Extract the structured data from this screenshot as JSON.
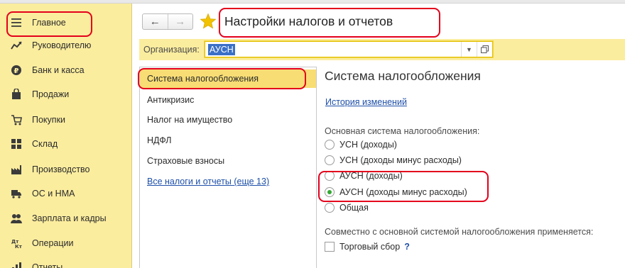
{
  "sidebar": {
    "items": [
      {
        "label": "Главное",
        "icon": "menu-lines-icon"
      },
      {
        "label": "Руководителю",
        "icon": "trend-chart-icon"
      },
      {
        "label": "Банк и касса",
        "icon": "ruble-coin-icon"
      },
      {
        "label": "Продажи",
        "icon": "shopping-bag-icon"
      },
      {
        "label": "Покупки",
        "icon": "cart-icon"
      },
      {
        "label": "Склад",
        "icon": "warehouse-grid-icon"
      },
      {
        "label": "Производство",
        "icon": "factory-icon"
      },
      {
        "label": "ОС и НМА",
        "icon": "truck-icon"
      },
      {
        "label": "Зарплата и кадры",
        "icon": "people-icon"
      },
      {
        "label": "Операции",
        "icon": "dt-kt-icon"
      },
      {
        "label": "Отчеты",
        "icon": "report-chart-icon"
      }
    ]
  },
  "header": {
    "title": "Настройки налогов и отчетов"
  },
  "organization": {
    "label": "Организация:",
    "value": "АУСН"
  },
  "list": {
    "items": [
      "Система налогообложения",
      "Антикризис",
      "Налог на имущество",
      "НДФЛ",
      "Страховые взносы"
    ],
    "link": "Все налоги и отчеты (еще 13)"
  },
  "main": {
    "title": "Система налогообложения",
    "history_link": "История изменений",
    "tax_system_label": "Основная система налогообложения:",
    "options": [
      {
        "label": "УСН (доходы)",
        "selected": false
      },
      {
        "label": "УСН (доходы минус расходы)",
        "selected": false
      },
      {
        "label": "АУСН (доходы)",
        "selected": false
      },
      {
        "label": "АУСН (доходы минус расходы)",
        "selected": true
      },
      {
        "label": "Общая",
        "selected": false
      }
    ],
    "combined_label": "Совместно с основной системой налогообложения применяется:",
    "trade_fee_label": "Торговый сбор",
    "help_mark": "?"
  },
  "colors": {
    "sidebar_bg": "#fbed9e",
    "active_item": "#f8dd74",
    "link": "#1e4fa8",
    "selected_radio": "#32a832",
    "annotation": "#e3001b"
  }
}
